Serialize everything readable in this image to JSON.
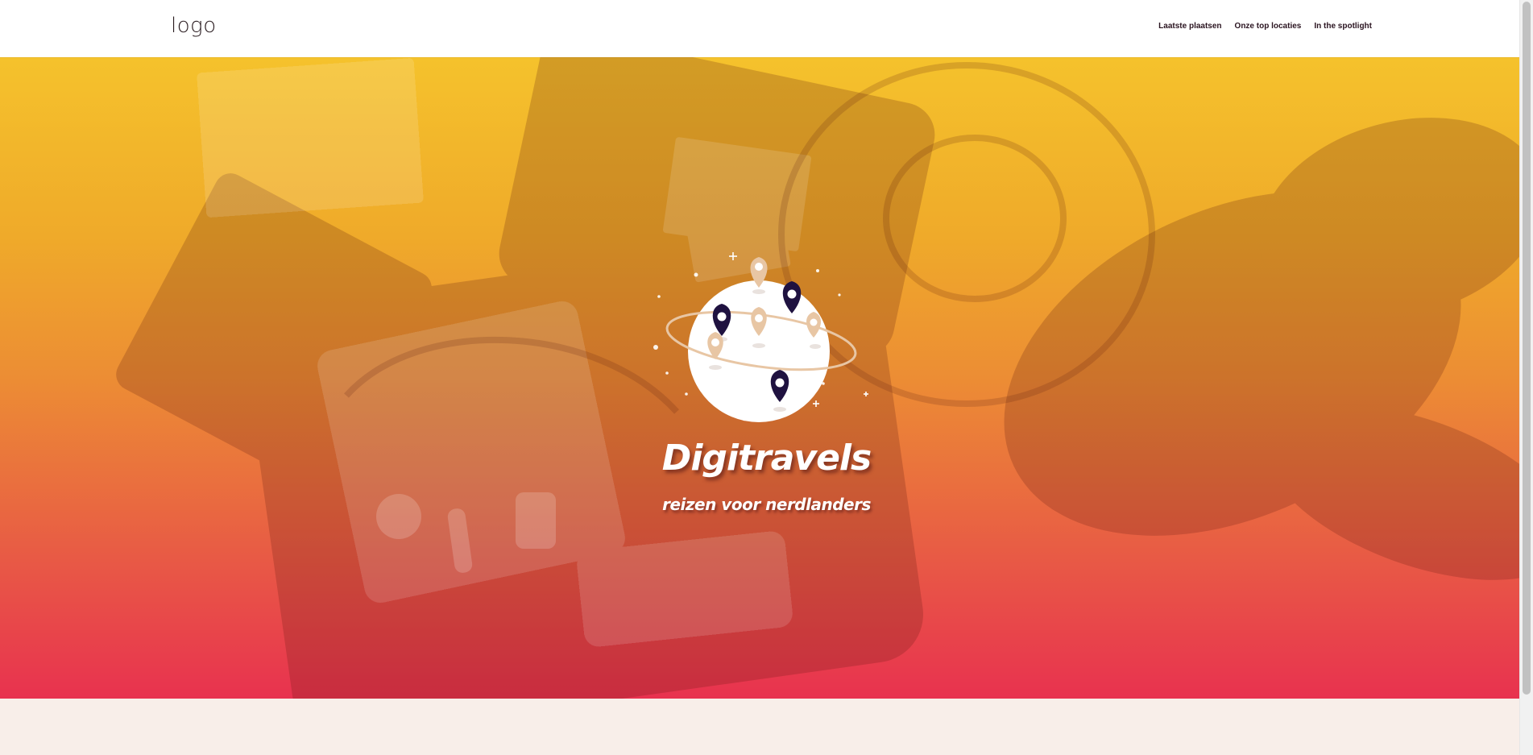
{
  "header": {
    "logo_text": "logo",
    "nav": [
      {
        "label": "Laatste plaatsen"
      },
      {
        "label": "Onze top locaties"
      },
      {
        "label": "In the spotlight"
      }
    ]
  },
  "hero": {
    "title": "Digitravels",
    "subtitle": "reizen voor nerdlanders",
    "gradient_top_color": "#f5c22c",
    "gradient_bottom_color": "#e8324f",
    "emblem_pin_light_color": "#e8c6a4",
    "emblem_pin_dark_color": "#1f1240"
  },
  "below_section": {
    "background_color": "#f8eee9"
  },
  "icons": {
    "logo": "logo-wordmark",
    "emblem": "globe-with-map-pins-icon",
    "background_photo": "suitcase-flatlay-photo"
  }
}
